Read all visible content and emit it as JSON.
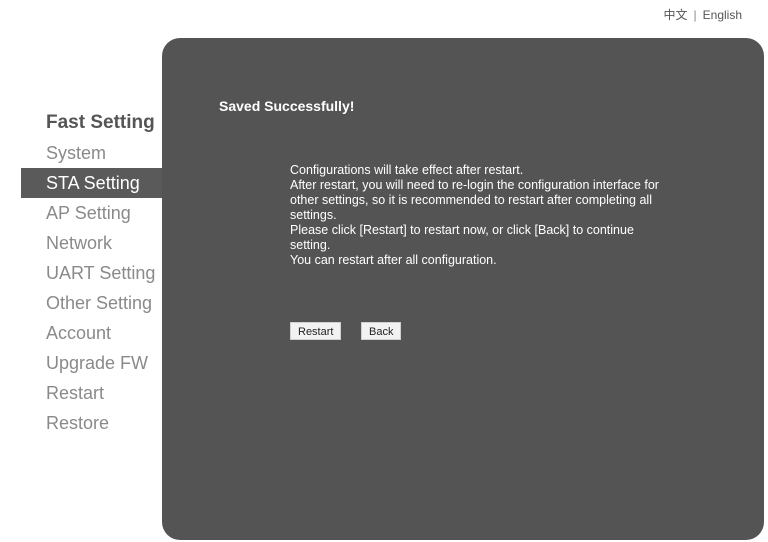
{
  "language": {
    "chinese": "中文",
    "separator": "|",
    "english": "English"
  },
  "sidebar": {
    "items": [
      {
        "label": "Fast Setting"
      },
      {
        "label": "System"
      },
      {
        "label": "STA Setting"
      },
      {
        "label": "AP Setting"
      },
      {
        "label": "Network"
      },
      {
        "label": "UART Setting"
      },
      {
        "label": "Other Setting"
      },
      {
        "label": "Account"
      },
      {
        "label": "Upgrade FW"
      },
      {
        "label": "Restart"
      },
      {
        "label": "Restore"
      }
    ],
    "active": "STA Setting"
  },
  "panel": {
    "title": "Saved Successfully!",
    "lines": [
      "Configurations will take effect after restart.",
      "After restart, you will need to re-login the configuration interface for other settings, so it is recommended to restart after completing all settings.",
      "Please click [Restart] to restart now, or click [Back] to continue setting.",
      "You can restart after all configuration."
    ],
    "restart_label": "Restart",
    "back_label": "Back"
  },
  "colors": {
    "panel": "#545454",
    "active_item": "#5a5a5a",
    "nav_text": "#8a8a8a"
  }
}
